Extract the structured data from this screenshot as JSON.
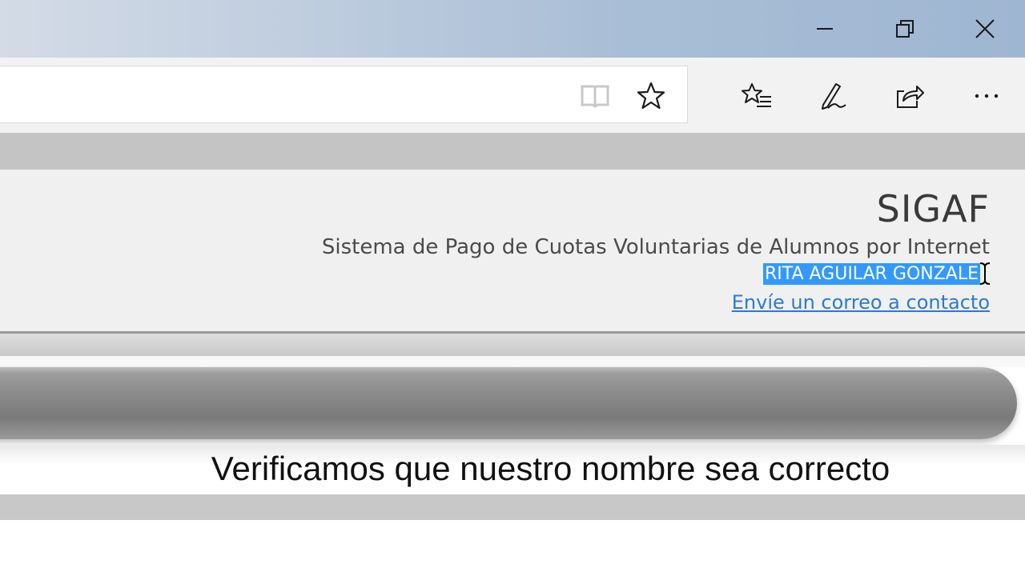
{
  "window": {
    "controls": [
      {
        "name": "minimize",
        "icon": "minimize-icon"
      },
      {
        "name": "restore",
        "icon": "restore-icon"
      },
      {
        "name": "close",
        "icon": "close-icon"
      }
    ]
  },
  "toolbar": {
    "address_value": "",
    "icons": [
      "reading-view-icon",
      "favorite-star-icon",
      "favorites-list-icon",
      "web-note-pen-icon",
      "share-icon",
      "more-icon"
    ]
  },
  "header": {
    "title": "SIGAF",
    "subtitle": "Sistema de Pago de Cuotas Voluntarias de Alumnos por Internet",
    "user_name": "RITA AGUILAR GONZALE",
    "contact_link": "Envíe un correo a contacto"
  },
  "caption": {
    "text": "Verificamos que nuestro nombre sea correcto"
  },
  "colors": {
    "selection": "#3399ff",
    "link": "#2a7ad6",
    "titlebar": "#a9bed6"
  }
}
